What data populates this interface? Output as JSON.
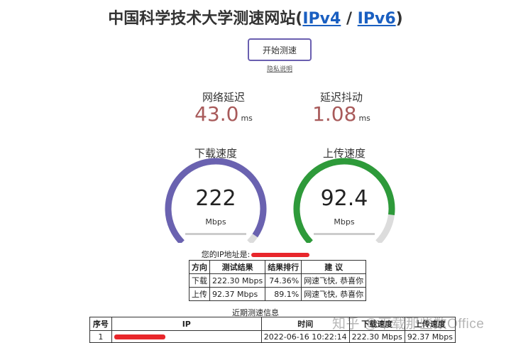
{
  "header": {
    "title_prefix": "中国科学技术大学测速网站(",
    "ipv4_link": "IPv4",
    "separator": " / ",
    "ipv6_link": "IPv6",
    "title_suffix": ")"
  },
  "controls": {
    "start_button": "开始测速",
    "privacy_link": "隐私说明"
  },
  "latency": {
    "label": "网络延迟",
    "value": "43.0",
    "unit": "ms"
  },
  "jitter": {
    "label": "延迟抖动",
    "value": "1.08",
    "unit": "ms"
  },
  "download": {
    "label": "下载速度",
    "value": "222",
    "unit": "Mbps",
    "gauge_fraction": 0.96,
    "color": "#6a62b0"
  },
  "upload": {
    "label": "上传速度",
    "value": "92.4",
    "unit": "Mbps",
    "gauge_fraction": 0.86,
    "color": "#2e9a3a"
  },
  "ip_info": {
    "label": "您的IP地址是:"
  },
  "result_table": {
    "headers": [
      "方向",
      "测试结果",
      "结果排行",
      "建 议"
    ],
    "rows": [
      [
        "下载",
        "222.30 Mbps",
        "74.36%",
        "网速飞快, 恭喜你"
      ],
      [
        "上传",
        "92.37 Mbps",
        "89.1%",
        "网速飞快, 恭喜你"
      ]
    ]
  },
  "recent": {
    "title": "近期测速信息",
    "headers": [
      "序号",
      "IP",
      "时间",
      "下载速度",
      "上传速度"
    ],
    "rows": [
      [
        "1",
        "",
        "2022-06-16 10:22:14",
        "222.30 Mbps",
        "92.37 Mbps"
      ]
    ]
  },
  "watermark": "知乎 @下载那些数Office"
}
